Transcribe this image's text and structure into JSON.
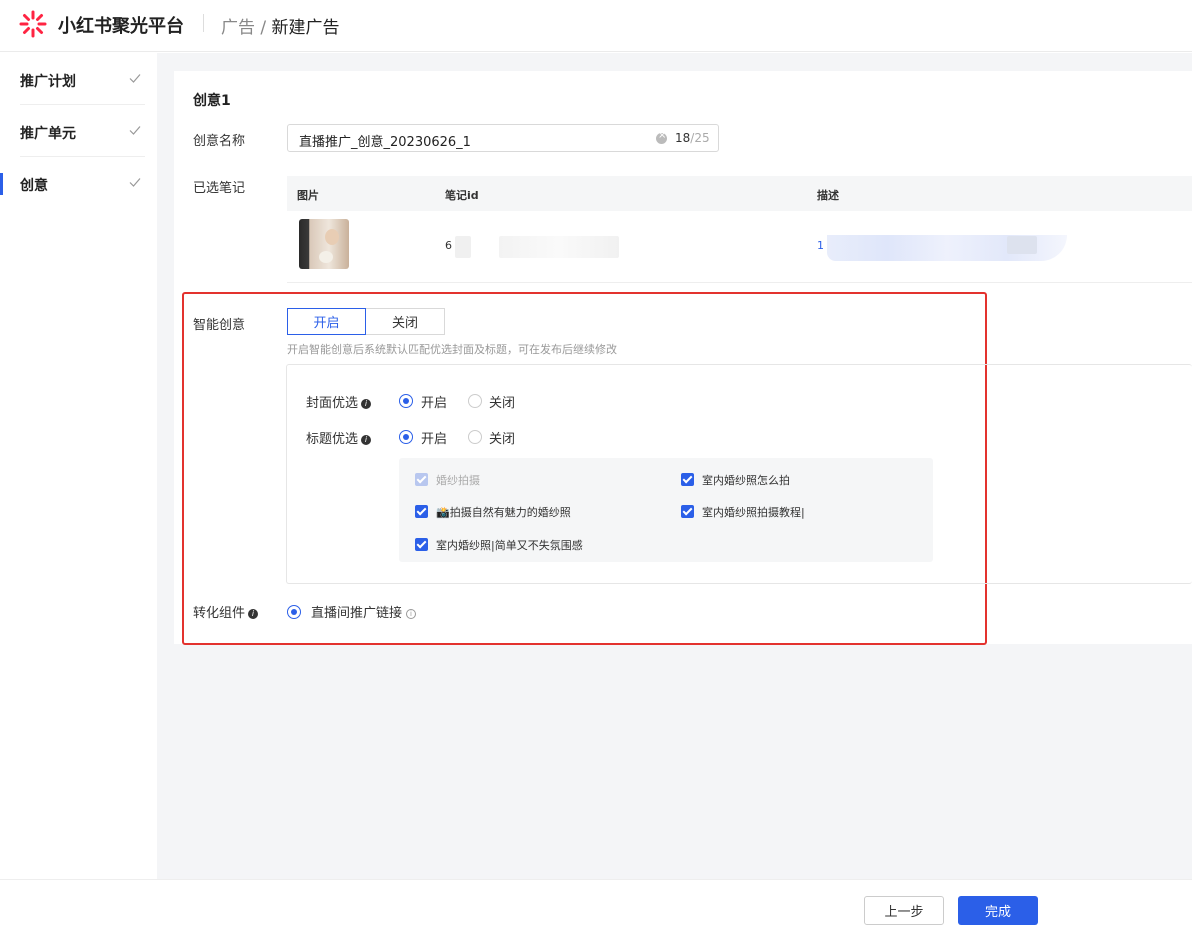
{
  "header": {
    "brand": "小红书聚光平台",
    "crumb_parent": "广告",
    "crumb_sep": " / ",
    "crumb_current": "新建广告"
  },
  "sidebar": {
    "items": [
      {
        "label": "推广计划"
      },
      {
        "label": "推广单元"
      },
      {
        "label": "创意"
      }
    ]
  },
  "creative": {
    "title": "创意1",
    "name_label": "创意名称",
    "name_value": "直播推广_创意_20230626_1",
    "name_count": "18",
    "name_max": "/25",
    "notes_label": "已选笔记",
    "table_headers": {
      "image": "图片",
      "note_id": "笔记id",
      "desc": "描述"
    },
    "row": {
      "note_id_prefix": "6",
      "desc_prefix": "1"
    }
  },
  "smart": {
    "label": "智能创意",
    "on_label": "开启",
    "off_label": "关闭",
    "hint": "开启智能创意后系统默认匹配优选封面及标题，可在发布后继续修改",
    "cover_label": "封面优选",
    "title_label": "标题优选",
    "radio_on": "开启",
    "radio_off": "关闭",
    "titles": [
      {
        "text": "婚纱拍摄",
        "checked": true,
        "disabled": true
      },
      {
        "text": "室内婚纱照怎么拍",
        "checked": true,
        "disabled": false
      },
      {
        "text": "📸拍摄自然有魅力的婚纱照",
        "checked": true,
        "disabled": false
      },
      {
        "text": "室内婚纱照拍摄教程|",
        "checked": true,
        "disabled": false
      },
      {
        "text": "室内婚纱照|简单又不失氛围感",
        "checked": true,
        "disabled": false
      }
    ]
  },
  "conversion": {
    "label": "转化组件",
    "option": "直播间推广链接"
  },
  "footer": {
    "prev": "上一步",
    "done": "完成"
  },
  "colors": {
    "primary": "#2b5fe8",
    "highlight_border": "#e3322e",
    "brand_red": "#ff2442"
  }
}
